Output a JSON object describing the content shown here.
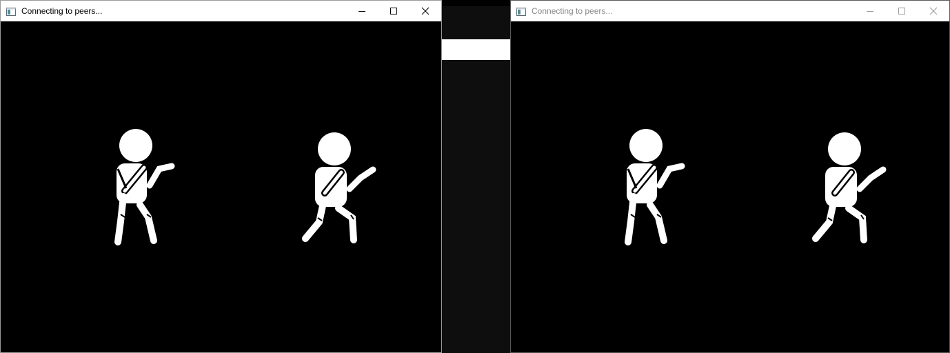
{
  "windows": [
    {
      "id": "left",
      "title": "Connecting to peers...",
      "active": true,
      "controls": [
        "minimize-icon",
        "maximize-icon",
        "close-icon"
      ]
    },
    {
      "id": "right",
      "title": "Connecting to peers...",
      "active": false,
      "controls": [
        "minimize-icon",
        "maximize-icon",
        "close-icon"
      ]
    }
  ],
  "colors": {
    "background": "#000000",
    "figure": "#ffffff",
    "titlebar": "#ffffff",
    "inactive_title_text": "#8a8a8a"
  }
}
